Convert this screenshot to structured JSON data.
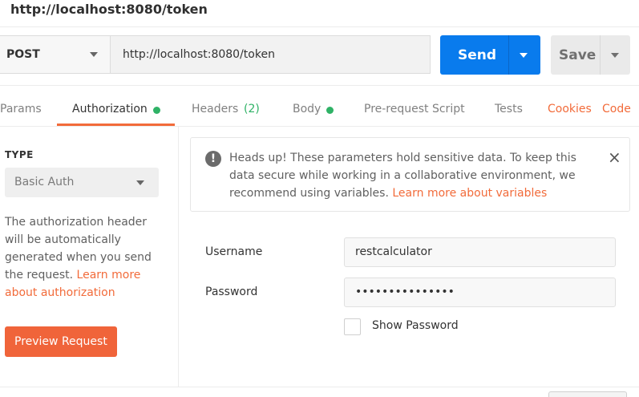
{
  "window": {
    "title": "http://localhost:8080/token"
  },
  "request": {
    "method": "POST",
    "url": "http://localhost:8080/token",
    "send_label": "Send",
    "save_label": "Save"
  },
  "tabs": [
    {
      "label": "Params"
    },
    {
      "label": "Authorization",
      "active": true,
      "dot": true
    },
    {
      "label": "Headers",
      "count": "(2)"
    },
    {
      "label": "Body",
      "dot": true
    },
    {
      "label": "Pre-request Script"
    },
    {
      "label": "Tests"
    }
  ],
  "tab_links": {
    "cookies": "Cookies",
    "code": "Code"
  },
  "auth": {
    "type_heading": "TYPE",
    "type_value": "Basic Auth",
    "description": "The authorization header will be automatically generated when you send the request. ",
    "learn_more": "Learn more about authorization",
    "preview_button": "Preview Request"
  },
  "notice": {
    "icon": "!",
    "text": "Heads up! These parameters hold sensitive data. To keep this data secure while working in a collaborative environment, we recommend using variables. ",
    "link": "Learn more about variables",
    "close": "×"
  },
  "fields": {
    "username_label": "Username",
    "username_value": "restcalculator",
    "password_label": "Password",
    "password_value": "•••••••••••••••",
    "show_password_label": "Show Password"
  },
  "colors": {
    "accent": "#f26b3a",
    "send": "#097bed",
    "dot": "#2fb266",
    "headers_count": "#2fb266"
  }
}
